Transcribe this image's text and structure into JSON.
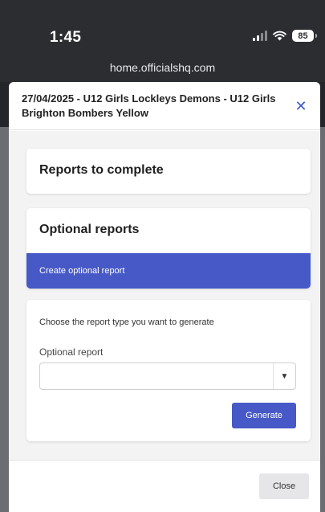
{
  "status_bar": {
    "time": "1:45",
    "battery": "85",
    "icons": [
      "signal-icon",
      "wifi-icon",
      "battery-icon"
    ]
  },
  "browser": {
    "url": "home.officialshq.com"
  },
  "modal": {
    "title": "27/04/2025 - U12 Girls Lockleys Demons - U12 Girls Brighton Bombers Yellow",
    "close_icon": "close-icon",
    "sections": {
      "reports_to_complete": "Reports to complete",
      "optional_reports": "Optional reports",
      "create_optional": "Create optional report"
    },
    "form": {
      "description": "Choose the report type you want to generate",
      "label": "Optional report",
      "selected_value": "",
      "generate_label": "Generate"
    },
    "footer": {
      "close_label": "Close"
    }
  },
  "colors": {
    "accent": "#4759c7",
    "status_bar": "#2c2d31",
    "body_bg": "#f3f3f3"
  }
}
